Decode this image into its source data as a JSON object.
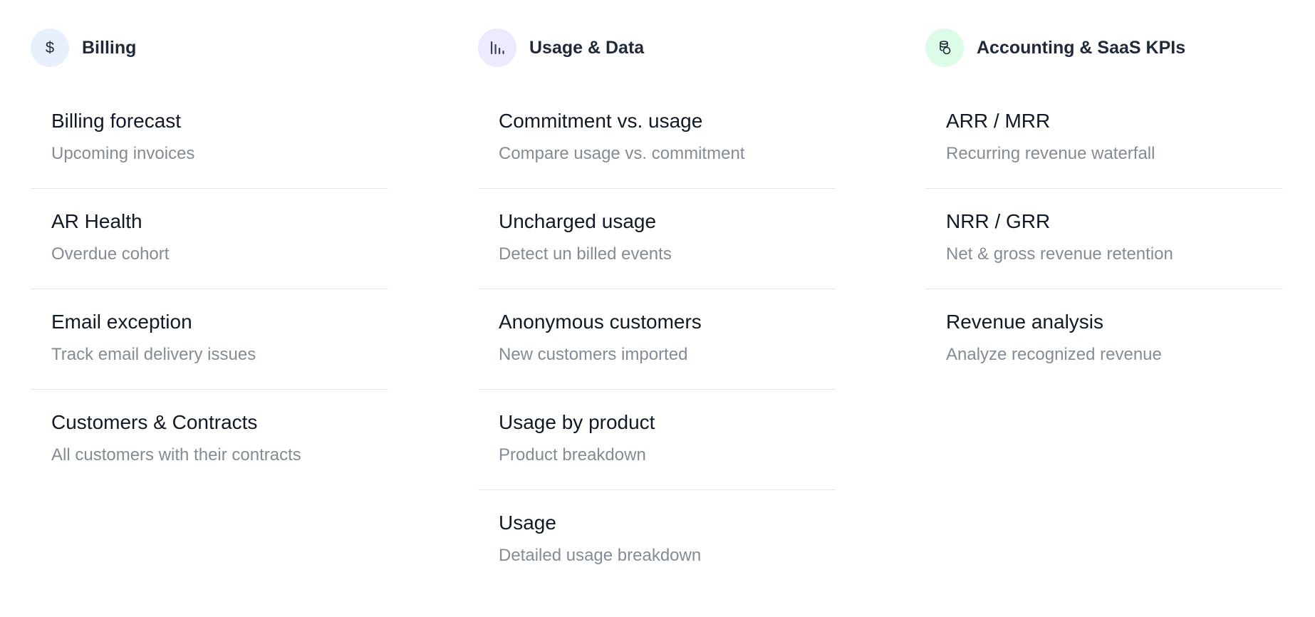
{
  "columns": [
    {
      "title": "Billing",
      "icon": "dollar-icon",
      "icon_color": "#e8f0fe",
      "items": [
        {
          "title": "Billing forecast",
          "description": "Upcoming invoices"
        },
        {
          "title": "AR Health",
          "description": "Overdue cohort"
        },
        {
          "title": "Email exception",
          "description": "Track email delivery issues"
        },
        {
          "title": "Customers & Contracts",
          "description": "All customers with their contracts"
        }
      ]
    },
    {
      "title": "Usage & Data",
      "icon": "bar-chart-icon",
      "icon_color": "#ede9fe",
      "items": [
        {
          "title": "Commitment vs. usage",
          "description": "Compare usage vs. commitment"
        },
        {
          "title": "Uncharged usage",
          "description": "Detect un billed events"
        },
        {
          "title": "Anonymous customers",
          "description": "New customers imported"
        },
        {
          "title": "Usage by product",
          "description": "Product breakdown"
        },
        {
          "title": "Usage",
          "description": "Detailed usage breakdown"
        }
      ]
    },
    {
      "title": "Accounting & SaaS KPIs",
      "icon": "coins-icon",
      "icon_color": "#dcfce7",
      "items": [
        {
          "title": "ARR / MRR",
          "description": "Recurring revenue waterfall"
        },
        {
          "title": "NRR / GRR",
          "description": "Net & gross revenue retention"
        },
        {
          "title": "Revenue analysis",
          "description": "Analyze recognized revenue"
        }
      ]
    }
  ]
}
